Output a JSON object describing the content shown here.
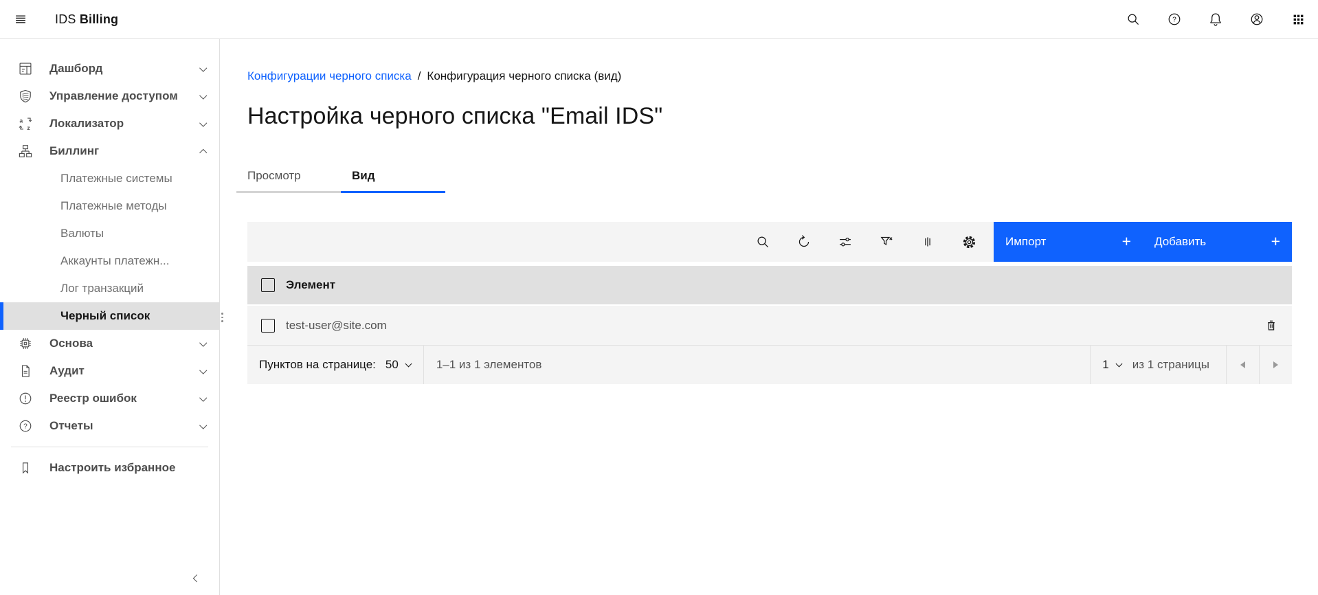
{
  "header": {
    "brand_prefix": "IDS",
    "brand_suffix": "Billing"
  },
  "sidebar": {
    "items": [
      {
        "label": "Дашборд"
      },
      {
        "label": "Управление доступом"
      },
      {
        "label": "Локализатор"
      },
      {
        "label": "Биллинг"
      },
      {
        "label": "Основа"
      },
      {
        "label": "Аудит"
      },
      {
        "label": "Реестр ошибок"
      },
      {
        "label": "Отчеты"
      }
    ],
    "billing_children": [
      {
        "label": "Платежные системы"
      },
      {
        "label": "Платежные методы"
      },
      {
        "label": "Валюты"
      },
      {
        "label": "Аккаунты платежн..."
      },
      {
        "label": "Лог транзакций"
      },
      {
        "label": "Черный список",
        "selected": true
      }
    ],
    "favorites_label": "Настроить избранное"
  },
  "breadcrumb": {
    "link": "Конфигурации черного списка",
    "separator": "/",
    "current": "Конфигурация черного списка (вид)"
  },
  "page": {
    "title": "Настройка черного списка \"Email IDS\""
  },
  "tabs": [
    {
      "label": "Просмотр",
      "active": false
    },
    {
      "label": "Вид",
      "active": true
    }
  ],
  "toolbar": {
    "import_label": "Импорт",
    "import_plus": "+",
    "add_label": "Добавить",
    "add_plus": "+"
  },
  "table": {
    "column_header": "Элемент",
    "rows": [
      {
        "value": "test-user@site.com"
      }
    ]
  },
  "pagination": {
    "per_page_label": "Пунктов на странице:",
    "per_page_value": "50",
    "range_text": "1–1 из 1 элементов",
    "current_page": "1",
    "total_pages_text": "из 1 страницы"
  },
  "colors": {
    "accent": "#0f62fe",
    "table_header_bg": "#e0e0e0",
    "layer_bg": "#f4f4f4"
  }
}
